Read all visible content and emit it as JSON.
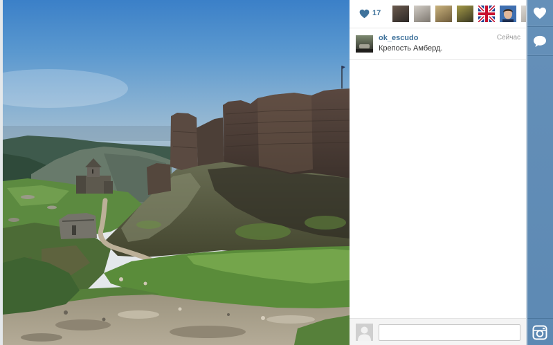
{
  "theme": {
    "accent_color": "#3f729b",
    "sidebar_color": "#5d89b3"
  },
  "post": {
    "likes": {
      "icon": "heart-icon",
      "count": "17"
    },
    "likers": [
      {
        "icon": "liker-avatar",
        "colors": [
          "#6b5a4e",
          "#2c2826"
        ]
      },
      {
        "icon": "liker-avatar",
        "colors": [
          "#d2cdc6",
          "#7e7870"
        ]
      },
      {
        "icon": "liker-avatar",
        "colors": [
          "#c9b27c",
          "#6f5c3c"
        ]
      },
      {
        "icon": "liker-avatar",
        "colors": [
          "#a49a48",
          "#3a3822"
        ]
      },
      {
        "icon": "union-jack-avatar",
        "colors": [
          "#1f3f8f",
          "#c8102e"
        ]
      },
      {
        "icon": "portrait-avatar",
        "colors": [
          "#3f6fb0",
          "#e2b79a"
        ]
      },
      {
        "icon": "liker-avatar",
        "colors": [
          "#dcd8d3",
          "#a7a19a"
        ]
      }
    ],
    "caption": {
      "author_icon": "author-avatar",
      "author_colors": [
        "#7d8a70",
        "#2b2a27"
      ],
      "username": "ok_escudo",
      "timestamp": "Сейчас",
      "text": "Крепость Амберд."
    },
    "comment_box": {
      "avatar_icon": "default-avatar-icon",
      "value": ""
    }
  },
  "sidebar": {
    "buttons": [
      {
        "icon": "heart-icon"
      },
      {
        "icon": "comment-icon"
      }
    ],
    "footer_icon": "instagram-icon"
  }
}
